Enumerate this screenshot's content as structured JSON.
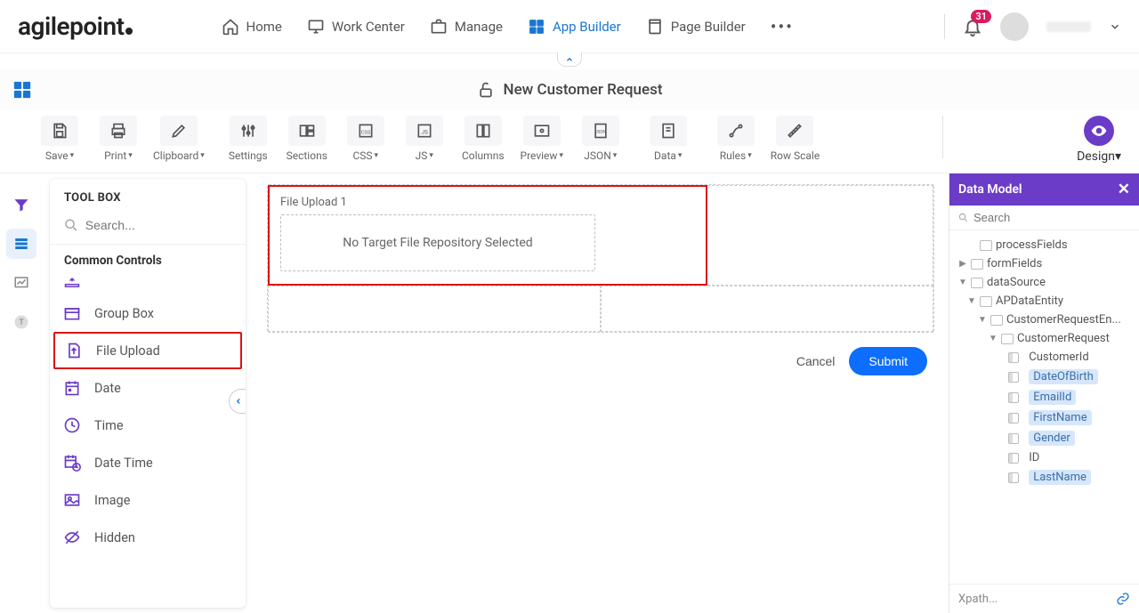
{
  "header": {
    "logo_text": "agilepoint",
    "nav": [
      {
        "label": "Home",
        "icon": "home"
      },
      {
        "label": "Work Center",
        "icon": "monitor"
      },
      {
        "label": "Manage",
        "icon": "briefcase"
      },
      {
        "label": "App Builder",
        "icon": "apps",
        "active": true
      },
      {
        "label": "Page Builder",
        "icon": "page"
      }
    ],
    "more": "…",
    "notif_count": "31"
  },
  "form_title": "New Customer Request",
  "toolbar": {
    "items": [
      {
        "label": "Save",
        "caret": true
      },
      {
        "label": "Print",
        "caret": true
      },
      {
        "label": "Clipboard",
        "caret": true
      },
      {
        "label": "Settings",
        "caret": false
      },
      {
        "label": "Sections",
        "caret": false
      },
      {
        "label": "CSS",
        "caret": true
      },
      {
        "label": "JS",
        "caret": true
      },
      {
        "label": "Columns",
        "caret": false
      },
      {
        "label": "Preview",
        "caret": true
      },
      {
        "label": "JSON",
        "caret": true
      },
      {
        "label": "Data",
        "caret": true
      },
      {
        "label": "Rules",
        "caret": true
      },
      {
        "label": "Row Scale",
        "caret": false
      }
    ],
    "design_label": "Design"
  },
  "toolbox": {
    "title": "TOOL BOX",
    "search_placeholder": "Search...",
    "section": "Common Controls",
    "items": [
      {
        "label": "Group Box",
        "icon": "groupbox"
      },
      {
        "label": "File Upload",
        "icon": "fileupload",
        "selected": true
      },
      {
        "label": "Date",
        "icon": "date"
      },
      {
        "label": "Time",
        "icon": "time"
      },
      {
        "label": "Date Time",
        "icon": "datetime"
      },
      {
        "label": "Image",
        "icon": "image"
      },
      {
        "label": "Hidden",
        "icon": "hidden"
      }
    ]
  },
  "canvas": {
    "fu_label": "File Upload 1",
    "fu_placeholder": "No Target File Repository Selected",
    "cancel": "Cancel",
    "submit": "Submit"
  },
  "datamodel": {
    "title": "Data Model",
    "search_placeholder": "Search",
    "footer": "Xpath...",
    "tree": {
      "processFields": "processFields",
      "formFields": "formFields",
      "dataSource": "dataSource",
      "APDataEntity": "APDataEntity",
      "CustomerRequestEnt": "CustomerRequestEn...",
      "CustomerRequest": "CustomerRequest",
      "fields": [
        "CustomerId",
        "DateOfBirth",
        "EmailId",
        "FirstName",
        "Gender",
        "ID",
        "LastName"
      ]
    }
  }
}
